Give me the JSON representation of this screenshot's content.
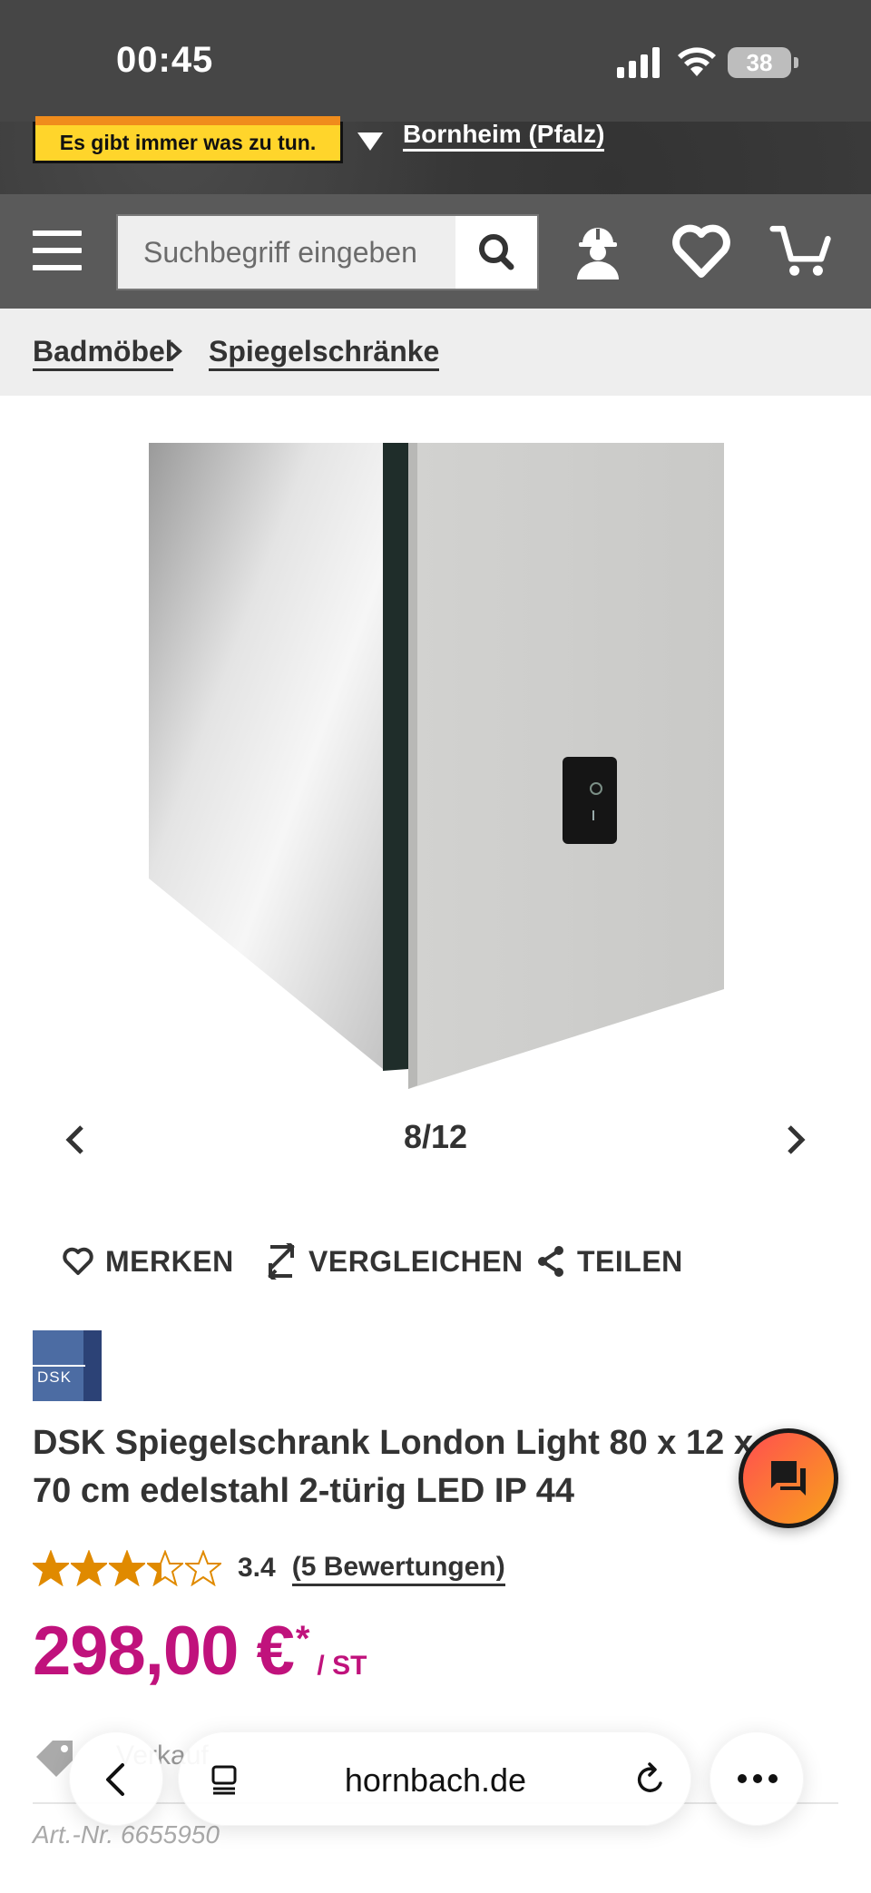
{
  "status_bar": {
    "time": "00:45",
    "battery": "38"
  },
  "header": {
    "logo_tagline": "Es gibt immer was zu tun.",
    "store_name": "Bornheim (Pfalz)"
  },
  "search": {
    "placeholder": "Suchbegriff eingeben"
  },
  "breadcrumb": {
    "items": [
      {
        "label": "Badmöbel"
      },
      {
        "label": "Spiegelschränke"
      }
    ]
  },
  "gallery": {
    "counter": "8/12"
  },
  "actions": {
    "merken": "MERKEN",
    "vergleichen": "VERGLEICHEN",
    "teilen": "TEILEN"
  },
  "brand": {
    "logo_text": "DSK"
  },
  "product": {
    "title": "DSK Spiegelschrank London Light 80 x 12 x 70 cm edelstahl 2-türig LED IP 44",
    "rating_value": "3.4",
    "rating_stars": 3.4,
    "reviews": "(5 Bewertungen)",
    "price": "298,00 €",
    "price_star": "*",
    "unit": "/ ST",
    "art_nr": "Art.-Nr. 6655950",
    "faded_text": "Verkauf"
  },
  "browser": {
    "url": "hornbach.de"
  },
  "colors": {
    "price": "#c0127c",
    "star": "#e08a00",
    "header": "#5a5a5a",
    "logo": "#ffd52b"
  }
}
